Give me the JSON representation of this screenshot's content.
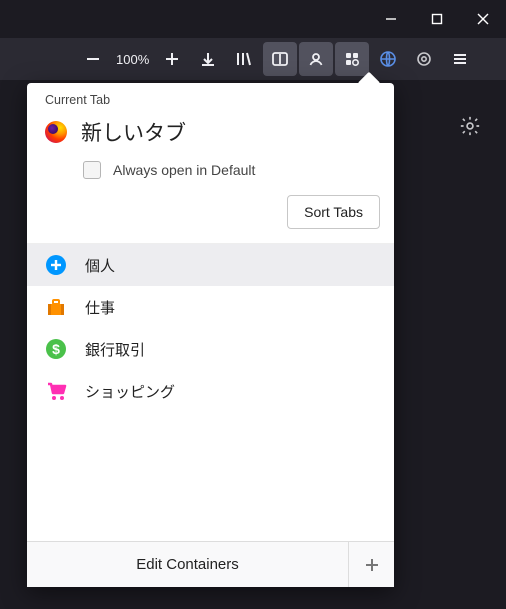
{
  "window": {
    "title": ""
  },
  "toolbar": {
    "zoom_label": "100%"
  },
  "panel": {
    "header": "Current Tab",
    "tab_title": "新しいタブ",
    "always_open_label": "Always open in Default",
    "sort_label": "Sort Tabs",
    "containers": [
      {
        "label": "個人",
        "icon": "plus-circle",
        "color": "#0097ff"
      },
      {
        "label": "仕事",
        "icon": "briefcase",
        "color": "#ff9100"
      },
      {
        "label": "銀行取引",
        "icon": "dollar-circle",
        "color": "#4ac14a"
      },
      {
        "label": "ショッピング",
        "icon": "cart",
        "color": "#ff2fb3"
      }
    ],
    "edit_label": "Edit Containers"
  }
}
